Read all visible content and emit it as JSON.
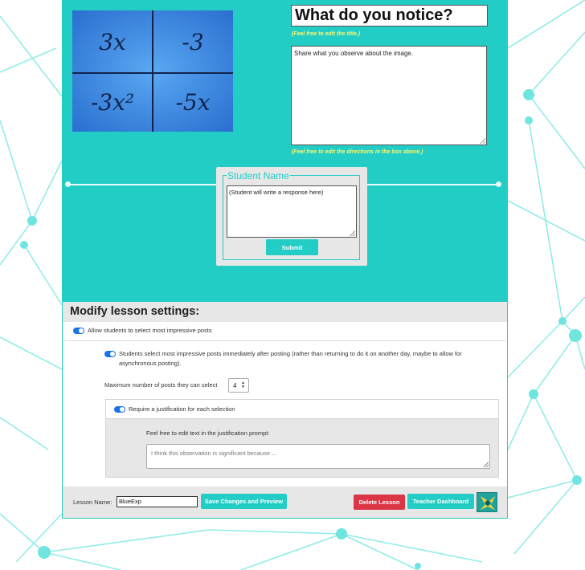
{
  "image_panel": {
    "cells": [
      "3x",
      "-3",
      "-3x²",
      "-5x"
    ]
  },
  "prompt": {
    "title_value": "What do you notice?",
    "title_hint": "(Feel free to edit the title.)",
    "directions_value": "Share what you observe about the image.",
    "directions_hint": "(Feel free to edit the directions in the box above.)"
  },
  "student_card": {
    "legend": "Student Name",
    "response_placeholder": "(Student will write a response here)",
    "submit_label": "Submit"
  },
  "settings": {
    "title": "Modify lesson settings:",
    "allow_select_label": "Allow students to select most impressive posts",
    "immediate_label": "Students select most impressive posts immediately after posting (rather than returning to do it on another day, maybe to allow for asynchronous posting).",
    "max_posts_label": "Maximum number of posts they can select",
    "max_posts_value": "4",
    "require_justification_label": "Require a justification for each selection",
    "justification_prompt_label": "Feel free to edit text in the justification prompt:",
    "justification_placeholder": "I think this observation is significant because ..."
  },
  "footer": {
    "lesson_name_label": "Lesson Name:",
    "lesson_name_value": "BlueExp",
    "save_label": "Save Changes and Preview",
    "delete_label": "Delete Lesson",
    "dashboard_label": "Teacher Dashboard"
  },
  "colors": {
    "teal": "#22cdc6",
    "toggle_blue": "#1a73e8",
    "delete_red": "#dc3545",
    "hint_yellow": "#fff56a"
  }
}
